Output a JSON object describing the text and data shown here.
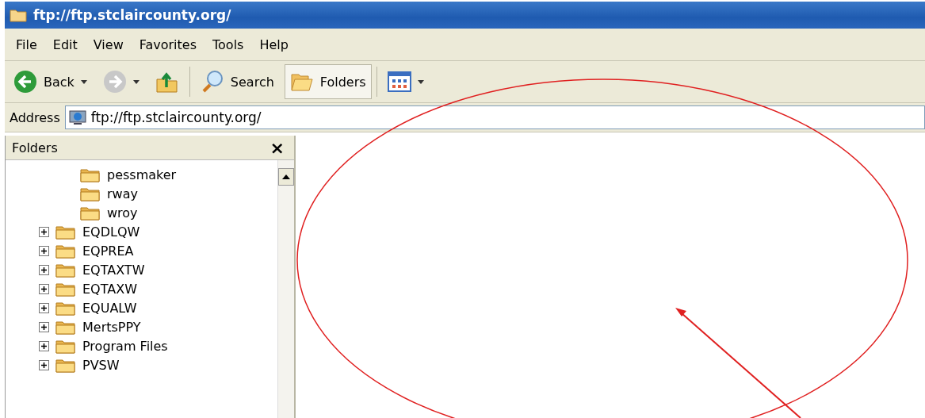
{
  "window": {
    "title": "ftp://ftp.stclaircounty.org/"
  },
  "menu": [
    {
      "label": "File"
    },
    {
      "label": "Edit"
    },
    {
      "label": "View"
    },
    {
      "label": "Favorites"
    },
    {
      "label": "Tools"
    },
    {
      "label": "Help"
    }
  ],
  "toolbar": [
    {
      "kind": "back",
      "label": "Back",
      "disabled": false
    },
    {
      "kind": "forward",
      "disabled": true
    },
    {
      "kind": "up"
    },
    {
      "kind": "search",
      "label": "Search",
      "selected": false
    },
    {
      "kind": "folders",
      "label": "Folders",
      "selected": true
    },
    {
      "kind": "views"
    }
  ],
  "address": {
    "label": "Address",
    "value": "ftp://ftp.stclaircounty.org/"
  },
  "folders_pane": {
    "title": "Folders",
    "close": "×",
    "tree": {
      "hidden_parent_children": [
        {
          "name": "pessmaker"
        },
        {
          "name": "rway"
        },
        {
          "name": "wroy"
        }
      ],
      "items": [
        {
          "name": "EQDLQW",
          "expanded": false
        },
        {
          "name": "EQPREA",
          "expanded": false
        },
        {
          "name": "EQTAXTW",
          "expanded": false
        },
        {
          "name": "EQTAXW",
          "expanded": false
        },
        {
          "name": "EQUALW",
          "expanded": false
        },
        {
          "name": "MertsPPY",
          "expanded": false
        },
        {
          "name": "Program Files",
          "expanded": false
        },
        {
          "name": "PVSW",
          "expanded": false
        }
      ]
    }
  }
}
